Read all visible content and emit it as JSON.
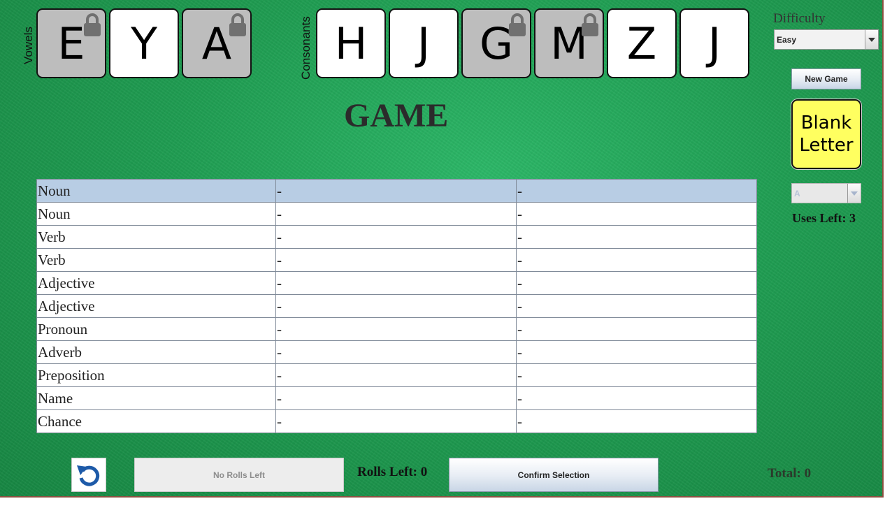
{
  "vowels": {
    "label": "Vowels",
    "tiles": [
      {
        "letter": "E",
        "locked": true
      },
      {
        "letter": "Y",
        "locked": false
      },
      {
        "letter": "A",
        "locked": true
      }
    ]
  },
  "consonants": {
    "label": "Consonants",
    "tiles": [
      {
        "letter": "H",
        "locked": false
      },
      {
        "letter": "J",
        "locked": false
      },
      {
        "letter": "G",
        "locked": true
      },
      {
        "letter": "M",
        "locked": true
      },
      {
        "letter": "Z",
        "locked": false
      },
      {
        "letter": "J",
        "locked": false
      }
    ]
  },
  "title": "GAME",
  "sidebar": {
    "difficulty_label": "Difficulty",
    "difficulty_value": "Easy",
    "new_game_label": "New Game",
    "blank_letter_line1": "Blank",
    "blank_letter_line2": "Letter",
    "blank_select_value": "A",
    "uses_left": "Uses Left: 3"
  },
  "score_table": {
    "selected_row": 0,
    "rows": [
      [
        "Noun",
        "-",
        "-"
      ],
      [
        "Noun",
        "-",
        "-"
      ],
      [
        "Verb",
        "-",
        "-"
      ],
      [
        "Verb",
        "-",
        "-"
      ],
      [
        "Adjective",
        "-",
        "-"
      ],
      [
        "Adjective",
        "-",
        "-"
      ],
      [
        "Pronoun",
        "-",
        "-"
      ],
      [
        "Adverb",
        "-",
        "-"
      ],
      [
        "Preposition",
        "-",
        "-"
      ],
      [
        "Name",
        "-",
        "-"
      ],
      [
        "Chance",
        "-",
        "-"
      ]
    ]
  },
  "footer": {
    "roll_label": "No Rolls Left",
    "rolls_left": "Rolls Left: 0",
    "confirm_label": "Confirm Selection",
    "total": "Total: 0"
  },
  "colors": {
    "felt": "#1f9e52",
    "locked_tile": "#bdbdbd",
    "blank_letter": "#ffff60",
    "selected_row": "#b8cde4"
  }
}
